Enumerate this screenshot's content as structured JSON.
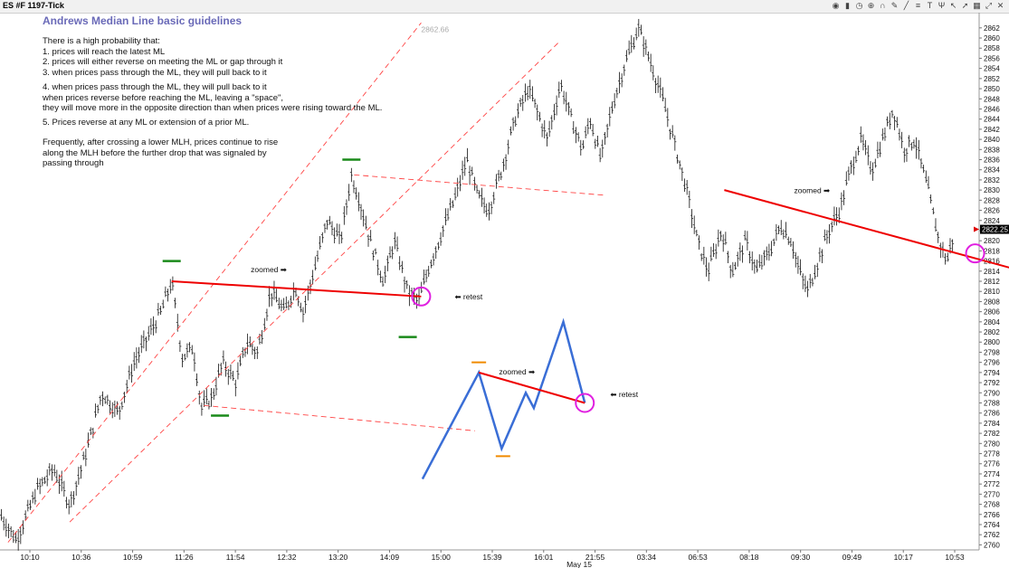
{
  "window": {
    "title": "ES #F 1197-Tick"
  },
  "toolbar": {
    "icons": [
      "chart-style-icon",
      "bar-type-icon",
      "clock-icon",
      "zoom-icon",
      "magnet-icon",
      "pencil-icon",
      "line-tool-icon",
      "fib-icon",
      "text-tool-icon",
      "pitchfork-icon",
      "cursor-icon",
      "arrow-icon",
      "grid-icon",
      "expand-icon",
      "close-icon"
    ]
  },
  "notes": {
    "heading": "Andrews Median Line basic guidelines",
    "block1": "There is a high probability that:\n1. prices will reach the latest ML\n2. prices will either reverse on meeting the ML or gap through it\n3. when prices pass through the ML, they will pull back to it",
    "block2": "4. when prices pass through the ML, they will pull back to it\nwhen prices reverse before reaching the ML, leaving a \"space\",\nthey will move more in the opposite direction than when prices were rising toward the ML.",
    "block3": "5. Prices reverse at any ML or extension of a prior ML.",
    "block4": "Frequently, after crossing a lower MLH, prices continue to rise\nalong the MLH before the further drop that was signaled by\npassing through"
  },
  "chart_data": {
    "type": "line",
    "title": "ES #F 1197-Tick",
    "x_tick_labels": [
      "10:10",
      "10:36",
      "10:59",
      "11:26",
      "11:54",
      "12:32",
      "13:20",
      "14:09",
      "15:00",
      "15:39",
      "16:01",
      "21:55",
      "03:34",
      "06:53",
      "08:18",
      "09:30",
      "09:49",
      "10:17",
      "10:53"
    ],
    "date_label": "May 15",
    "ylim": [
      2759,
      2865
    ],
    "y_ticks": [
      2760,
      2762,
      2764,
      2766,
      2768,
      2770,
      2772,
      2774,
      2776,
      2778,
      2780,
      2782,
      2784,
      2786,
      2788,
      2790,
      2792,
      2794,
      2796,
      2798,
      2800,
      2802,
      2804,
      2806,
      2808,
      2810,
      2812,
      2814,
      2816,
      2818,
      2820,
      2822,
      2824,
      2826,
      2828,
      2830,
      2832,
      2834,
      2836,
      2838,
      2840,
      2842,
      2844,
      2846,
      2848,
      2850,
      2852,
      2854,
      2856,
      2858,
      2860,
      2862
    ],
    "last_price": "2822.25",
    "price_path": [
      {
        "x": 0,
        "y": 2766
      },
      {
        "x": 0.6,
        "y": 2761
      },
      {
        "x": 1.4,
        "y": 2771
      },
      {
        "x": 2.0,
        "y": 2775
      },
      {
        "x": 2.6,
        "y": 2768
      },
      {
        "x": 3.2,
        "y": 2778
      },
      {
        "x": 3.8,
        "y": 2790
      },
      {
        "x": 4.4,
        "y": 2786
      },
      {
        "x": 5.0,
        "y": 2796
      },
      {
        "x": 5.6,
        "y": 2802
      },
      {
        "x": 6.0,
        "y": 2806
      },
      {
        "x": 6.4,
        "y": 2812
      },
      {
        "x": 6.8,
        "y": 2797
      },
      {
        "x": 7.2,
        "y": 2799
      },
      {
        "x": 7.5,
        "y": 2787
      },
      {
        "x": 7.9,
        "y": 2789
      },
      {
        "x": 8.3,
        "y": 2796
      },
      {
        "x": 8.8,
        "y": 2792
      },
      {
        "x": 9.2,
        "y": 2800
      },
      {
        "x": 9.6,
        "y": 2798
      },
      {
        "x": 10.1,
        "y": 2810
      },
      {
        "x": 10.6,
        "y": 2806
      },
      {
        "x": 11.0,
        "y": 2811
      },
      {
        "x": 11.3,
        "y": 2806
      },
      {
        "x": 11.7,
        "y": 2814
      },
      {
        "x": 12.2,
        "y": 2824
      },
      {
        "x": 12.7,
        "y": 2820
      },
      {
        "x": 13.1,
        "y": 2833
      },
      {
        "x": 13.4,
        "y": 2828
      },
      {
        "x": 13.8,
        "y": 2820
      },
      {
        "x": 14.3,
        "y": 2812
      },
      {
        "x": 14.7,
        "y": 2820
      },
      {
        "x": 15.2,
        "y": 2810
      },
      {
        "x": 15.6,
        "y": 2808
      },
      {
        "x": 16.0,
        "y": 2815
      },
      {
        "x": 16.5,
        "y": 2822
      },
      {
        "x": 17.0,
        "y": 2829
      },
      {
        "x": 17.4,
        "y": 2836
      },
      {
        "x": 17.8,
        "y": 2829
      },
      {
        "x": 18.2,
        "y": 2826
      },
      {
        "x": 18.7,
        "y": 2834
      },
      {
        "x": 19.2,
        "y": 2844
      },
      {
        "x": 19.7,
        "y": 2850
      },
      {
        "x": 20.0,
        "y": 2846
      },
      {
        "x": 20.4,
        "y": 2840
      },
      {
        "x": 20.9,
        "y": 2851
      },
      {
        "x": 21.3,
        "y": 2844
      },
      {
        "x": 21.7,
        "y": 2838
      },
      {
        "x": 22.0,
        "y": 2844
      },
      {
        "x": 22.4,
        "y": 2836
      },
      {
        "x": 22.8,
        "y": 2846
      },
      {
        "x": 23.3,
        "y": 2855
      },
      {
        "x": 23.8,
        "y": 2862
      },
      {
        "x": 24.2,
        "y": 2856
      },
      {
        "x": 24.7,
        "y": 2848
      },
      {
        "x": 25.2,
        "y": 2838
      },
      {
        "x": 25.6,
        "y": 2830
      },
      {
        "x": 26.0,
        "y": 2820
      },
      {
        "x": 26.4,
        "y": 2814
      },
      {
        "x": 26.9,
        "y": 2822
      },
      {
        "x": 27.3,
        "y": 2814
      },
      {
        "x": 27.8,
        "y": 2820
      },
      {
        "x": 28.2,
        "y": 2814
      },
      {
        "x": 28.7,
        "y": 2818
      },
      {
        "x": 29.1,
        "y": 2823
      },
      {
        "x": 29.5,
        "y": 2820
      },
      {
        "x": 29.8,
        "y": 2814
      },
      {
        "x": 30.1,
        "y": 2810
      },
      {
        "x": 30.5,
        "y": 2816
      },
      {
        "x": 30.9,
        "y": 2822
      },
      {
        "x": 31.3,
        "y": 2826
      },
      {
        "x": 31.7,
        "y": 2834
      },
      {
        "x": 32.1,
        "y": 2840
      },
      {
        "x": 32.5,
        "y": 2834
      },
      {
        "x": 32.9,
        "y": 2840
      },
      {
        "x": 33.3,
        "y": 2846
      },
      {
        "x": 33.7,
        "y": 2838
      },
      {
        "x": 34.1,
        "y": 2840
      },
      {
        "x": 34.6,
        "y": 2830
      },
      {
        "x": 35.0,
        "y": 2820
      },
      {
        "x": 35.3,
        "y": 2816
      },
      {
        "x": 35.6,
        "y": 2822
      }
    ],
    "annotations": [
      {
        "text": "zoomed ➡",
        "x": 9.35,
        "y": 2813.8
      },
      {
        "text": "⬅ retest",
        "x": 16.95,
        "y": 2808.4
      },
      {
        "text": "zoomed ➡",
        "x": 18.6,
        "y": 2793.6
      },
      {
        "text": "⬅ retest",
        "x": 22.75,
        "y": 2789.2
      },
      {
        "text": "zoomed ➡",
        "x": 29.6,
        "y": 2829.4
      },
      {
        "text": "2862.66",
        "x": 15.7,
        "y": 2861.2
      }
    ],
    "colors": {
      "median_line": "#ee0000",
      "channel": "#ff4444",
      "pivot_high": "#1a8a1a",
      "pivot_low": "#1a8a1a",
      "zigzag": "#3a6ed6",
      "zigzag_pivot": "#f08a00",
      "retest_circle": "#e020e0",
      "bars": "#111111",
      "heading": "#6a6ab8"
    }
  }
}
